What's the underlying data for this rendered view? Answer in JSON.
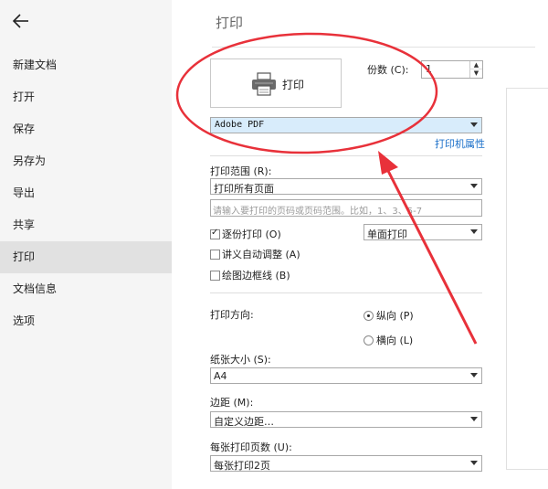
{
  "sidebar": {
    "items": [
      {
        "label": "新建文档"
      },
      {
        "label": "打开"
      },
      {
        "label": "保存"
      },
      {
        "label": "另存为"
      },
      {
        "label": "导出"
      },
      {
        "label": "共享"
      },
      {
        "label": "打印",
        "active": true
      },
      {
        "label": "文档信息"
      },
      {
        "label": "选项"
      }
    ]
  },
  "header": {
    "title": "打印"
  },
  "print_button": {
    "label": "打印",
    "icon": "printer-icon"
  },
  "copies": {
    "label": "份数 (C):",
    "value": "1"
  },
  "printer": {
    "selected": "Adobe PDF",
    "properties_link": "打印机属性"
  },
  "print_range": {
    "label": "打印范围 (R):",
    "selected": "打印所有页面",
    "input_placeholder": "请输入要打印的页码或页码范围。比如，1、3、5-7"
  },
  "options": {
    "collate": {
      "label": "逐份打印 (O)",
      "checked": true
    },
    "handout": {
      "label": "讲义自动调整 (A)",
      "checked": false
    },
    "border": {
      "label": "绘图边框线 (B)",
      "checked": false
    },
    "sides_selected": "单面打印"
  },
  "orientation": {
    "label": "打印方向:",
    "portrait": {
      "label": "纵向 (P)",
      "checked": true
    },
    "landscape": {
      "label": "横向 (L)",
      "checked": false
    }
  },
  "paper_size": {
    "label": "纸张大小 (S):",
    "selected": "A4"
  },
  "margins": {
    "label": "边距 (M):",
    "selected": "自定义边距…"
  },
  "pages_per_sheet": {
    "label": "每张打印页数 (U):",
    "selected": "每张打印2页"
  },
  "colors": {
    "annotation_red": "#e8313a",
    "link_blue": "#1a6fc9",
    "selection_blue": "#d8ecfb"
  }
}
